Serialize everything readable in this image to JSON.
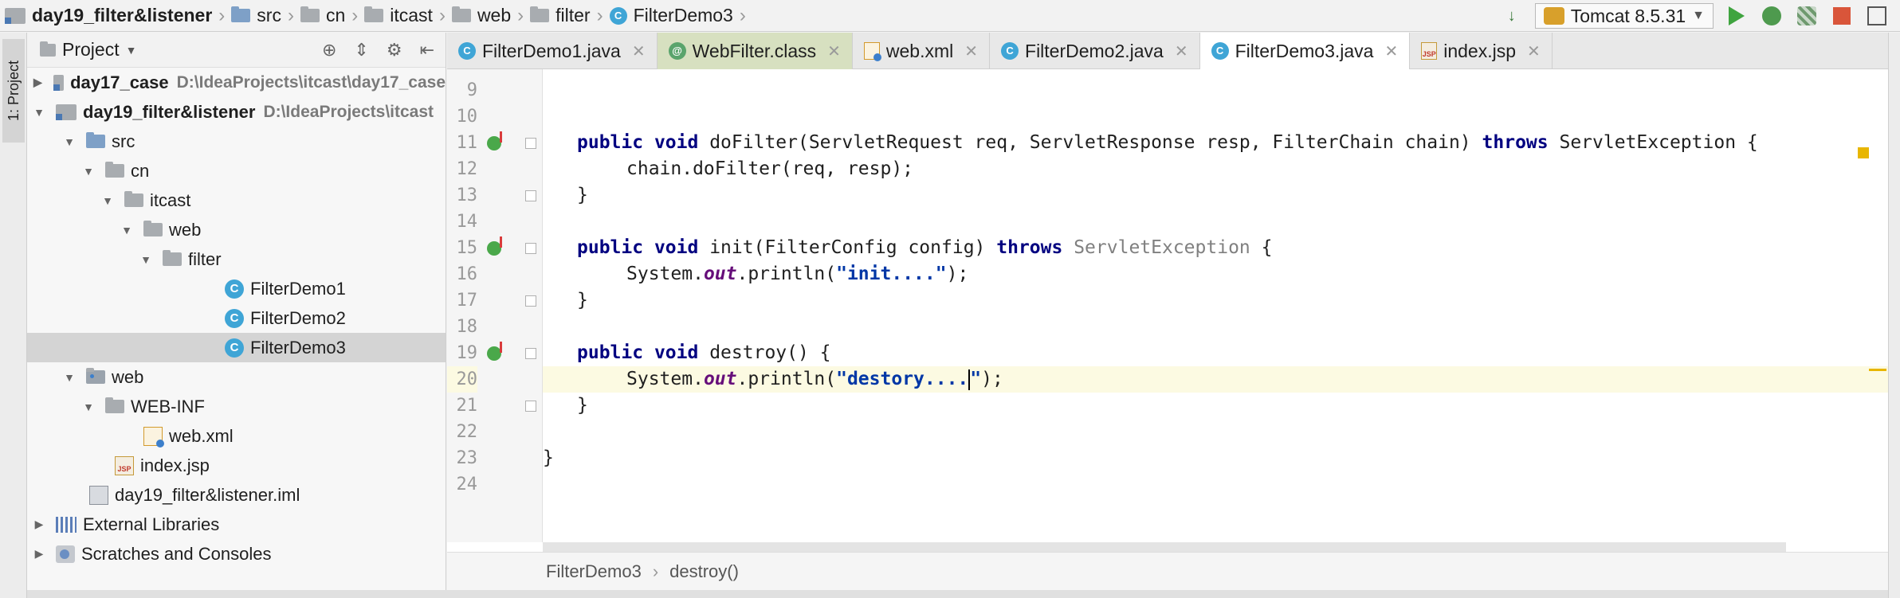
{
  "breadcrumb": {
    "items": [
      "day19_filter&listener",
      "src",
      "cn",
      "itcast",
      "web",
      "filter",
      "FilterDemo3"
    ]
  },
  "run": {
    "config": "Tomcat 8.5.31"
  },
  "left_strip": {
    "project_tab": "1: Project"
  },
  "project_panel": {
    "title": "Project",
    "tree": [
      {
        "label": "day17_case",
        "path": "D:\\IdeaProjects\\itcast\\day17_case"
      },
      {
        "label": "day19_filter&listener",
        "path": "D:\\IdeaProjects\\itcast"
      },
      {
        "label": "src"
      },
      {
        "label": "cn"
      },
      {
        "label": "itcast"
      },
      {
        "label": "web"
      },
      {
        "label": "filter"
      },
      {
        "label": "FilterDemo1"
      },
      {
        "label": "FilterDemo2"
      },
      {
        "label": "FilterDemo3"
      },
      {
        "label": "web"
      },
      {
        "label": "WEB-INF"
      },
      {
        "label": "web.xml"
      },
      {
        "label": "index.jsp"
      },
      {
        "label": "day19_filter&listener.iml"
      },
      {
        "label": "External Libraries"
      },
      {
        "label": "Scratches and Consoles"
      }
    ]
  },
  "tabs": [
    {
      "label": "FilterDemo1.java"
    },
    {
      "label": "WebFilter.class"
    },
    {
      "label": "web.xml"
    },
    {
      "label": "FilterDemo2.java"
    },
    {
      "label": "FilterDemo3.java"
    },
    {
      "label": "index.jsp"
    }
  ],
  "code": {
    "line_numbers": [
      "9",
      "10",
      "11",
      "12",
      "13",
      "14",
      "15",
      "16",
      "17",
      "18",
      "19",
      "20",
      "21",
      "22",
      "23",
      "24"
    ],
    "l11": {
      "kw1": "public",
      "kw2": "void",
      "sig": "doFilter(ServletRequest req, ServletResponse resp, FilterChain chain)",
      "kw3": "throws",
      "rest": "ServletException {"
    },
    "l12": "chain.doFilter(req, resp);",
    "l13": "}",
    "l15": {
      "kw1": "public",
      "kw2": "void",
      "sig": "init(FilterConfig config)",
      "kw3": "throws",
      "ghost": "ServletException",
      "rest": "{"
    },
    "l16": {
      "pre": "System.",
      "field": "out",
      "mid": ".println(",
      "str": "\"init....\"",
      "end": ");"
    },
    "l17": "}",
    "l19": {
      "kw1": "public",
      "kw2": "void",
      "sig": "destroy() {"
    },
    "l20": {
      "pre": "System.",
      "field": "out",
      "mid": ".println(",
      "str": "\"destory....",
      "str_end": "\"",
      "end": ");"
    },
    "l21": "}",
    "l23": "}"
  },
  "editor_breadcrumb": {
    "class": "FilterDemo3",
    "method": "destroy()"
  }
}
